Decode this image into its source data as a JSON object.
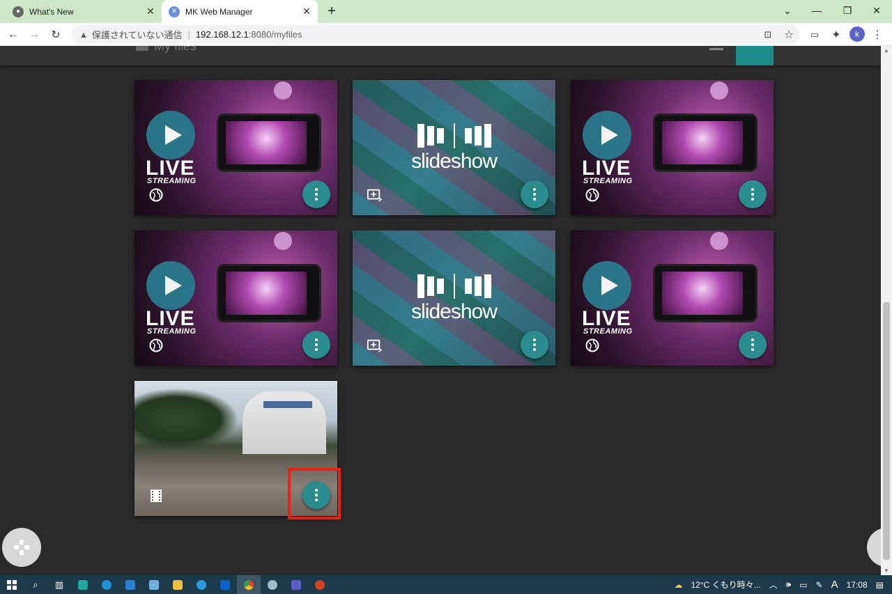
{
  "browser": {
    "tabs": [
      {
        "title": "What's New",
        "active": false
      },
      {
        "title": "MK Web Manager",
        "active": true
      }
    ],
    "omnibox": {
      "security_label": "保護されていない通信",
      "host": "192.168.12.1",
      "path": ":8080/myfiles"
    },
    "profile_initial": "k"
  },
  "app": {
    "page_title": "My files",
    "accent_color": "#2a8c8c"
  },
  "files": [
    {
      "type": "live",
      "label": "LIVE",
      "sub": "STREAMING",
      "type_icon": "globe-icon"
    },
    {
      "type": "slideshow",
      "label": "slideshow",
      "type_icon": "slideshow-icon"
    },
    {
      "type": "live",
      "label": "LIVE",
      "sub": "STREAMING",
      "type_icon": "globe-icon"
    },
    {
      "type": "live",
      "label": "LIVE",
      "sub": "STREAMING",
      "type_icon": "globe-icon"
    },
    {
      "type": "slideshow",
      "label": "slideshow",
      "type_icon": "slideshow-icon"
    },
    {
      "type": "live",
      "label": "LIVE",
      "sub": "STREAMING",
      "type_icon": "globe-icon"
    },
    {
      "type": "panorama-video",
      "type_icon": "film-icon",
      "highlighted": true
    }
  ],
  "taskbar": {
    "weather": "12°C くもり時々...",
    "ime": "A",
    "time": "17:08"
  }
}
